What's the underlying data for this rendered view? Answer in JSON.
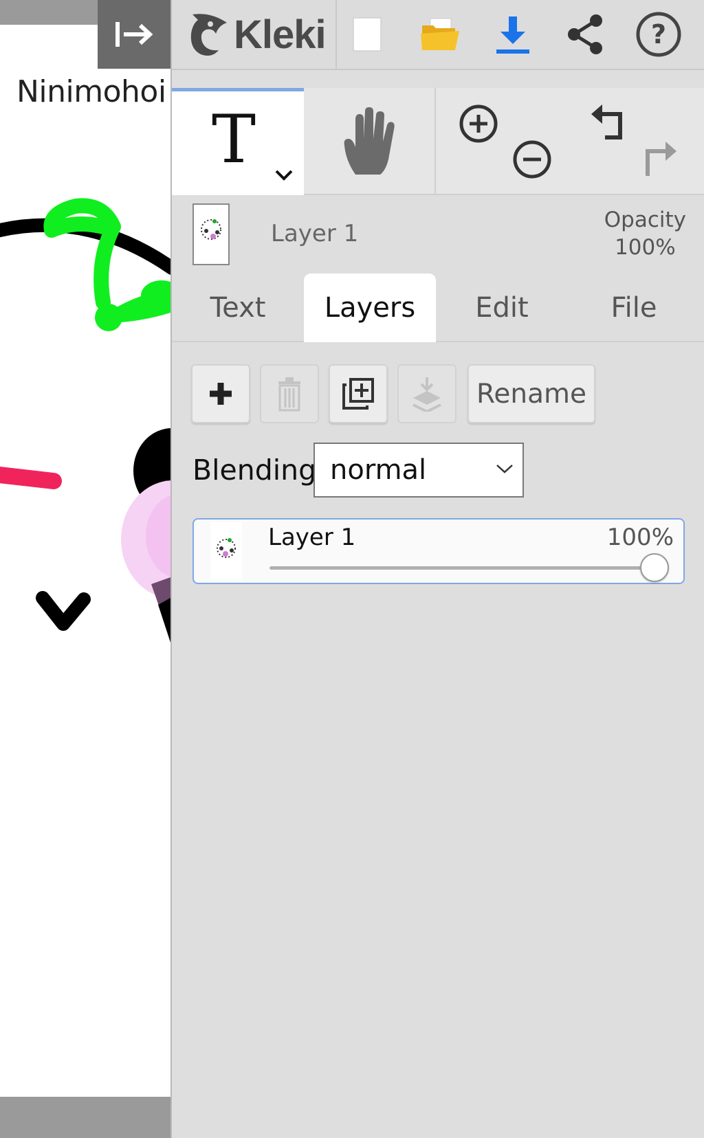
{
  "app": {
    "logo_text": "Kleki"
  },
  "canvas": {
    "visible_text": "Ninimohoi"
  },
  "tools": {
    "active_tool": "Text",
    "text_glyph": "T"
  },
  "layer_info": {
    "name": "Layer 1",
    "opacity_label": "Opacity",
    "opacity_value": "100%"
  },
  "tabs": [
    {
      "label": "Text",
      "active": false
    },
    {
      "label": "Layers",
      "active": true
    },
    {
      "label": "Edit",
      "active": false
    },
    {
      "label": "File",
      "active": false
    }
  ],
  "layers_panel": {
    "rename_label": "Rename",
    "blending_label": "Blending",
    "blending_value": "normal",
    "layers": [
      {
        "name": "Layer 1",
        "opacity_text": "100%",
        "opacity_fraction": 1.0
      }
    ]
  },
  "colors": {
    "accent": "#7fa7e6",
    "download_blue": "#1a73e8",
    "folder_yellow": "#f5c22b"
  }
}
